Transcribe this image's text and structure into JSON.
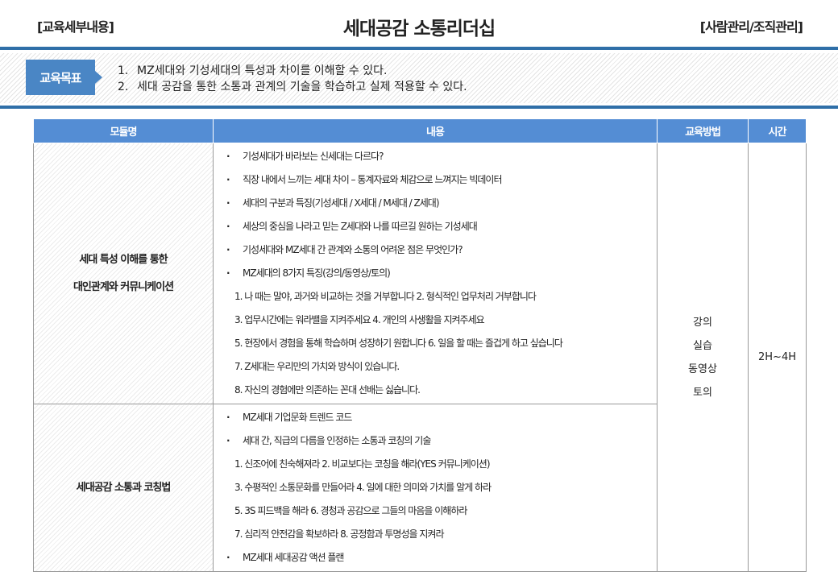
{
  "header": {
    "left": "[교육세부내용]",
    "title": "세대공감 소통리더십",
    "right": "[사람관리/조직관리]"
  },
  "objective": {
    "label": "교육목표",
    "items": [
      {
        "num": "1.",
        "text": "MZ세대와 기성세대의 특성과 차이를 이해할 수 있다."
      },
      {
        "num": "2.",
        "text": "세대 공감을 통한 소통과 관계의 기술을 학습하고 실제 적용할 수 있다."
      }
    ]
  },
  "table": {
    "headers": [
      "모듈명",
      "내용",
      "교육방법",
      "시간"
    ],
    "modules": [
      {
        "title_lines": [
          "세대 특성 이해를 통한",
          "대인관계와 커뮤니케이션"
        ],
        "lines": [
          {
            "type": "bullet",
            "text": "기성세대가 바라보는 신세대는 다르다?"
          },
          {
            "type": "bullet",
            "text": "직장 내에서 느끼는 세대 차이 – 통계자료와 체감으로 느껴지는 빅데이터"
          },
          {
            "type": "bullet",
            "text": "세대의 구분과 특징(기성세대 / X세대 / M세대 / Z세대)"
          },
          {
            "type": "bullet",
            "text": "세상의 중심을 나라고 믿는 Z세대와 나를 따르길 원하는 기성세대"
          },
          {
            "type": "bullet",
            "text": "기성세대와 MZ세대 간 관계와 소통의 어려운 점은 무엇인가?"
          },
          {
            "type": "bullet",
            "text": "MZ세대의 8가지 특징(강의/동영상/토의)"
          },
          {
            "type": "sub",
            "text": "1. 나 때는 말야, 과거와 비교하는 것을 거부합니다  2. 형식적인 업무처리 거부합니다"
          },
          {
            "type": "sub",
            "text": "3. 업무시간에는 워라밸을 지켜주세요  4. 개인의 사생활을 지켜주세요"
          },
          {
            "type": "sub",
            "text": "5. 현장에서 경험을 통해 학습하며 성장하기 원합니다  6. 일을 할 때는 즐겁게 하고 싶습니다"
          },
          {
            "type": "sub",
            "text": "7. Z세대는 우리만의 가치와 방식이 있습니다."
          },
          {
            "type": "sub",
            "text": "8. 자신의 경험에만 의존하는 꼰대 선배는 싫습니다."
          }
        ]
      },
      {
        "title_lines": [
          "세대공감 소통과 코칭법"
        ],
        "lines": [
          {
            "type": "bullet",
            "text": "MZ세대 기업문화 트렌드 코드"
          },
          {
            "type": "bullet",
            "text": "세대 간, 직급의 다름을 인정하는 소통과 코칭의 기술"
          },
          {
            "type": "sub",
            "text": "1. 신조어에 친숙해져라   2. 비교보다는 코칭을 해라(YES 커뮤니케이션)"
          },
          {
            "type": "sub",
            "text": "3. 수평적인 소통문화를 만들어라  4. 일에 대한 의미와 가치를 알게 하라"
          },
          {
            "type": "sub",
            "text": "5. 3S 피드백을 해라  6. 경청과 공감으로 그들의 마음을 이해하라"
          },
          {
            "type": "sub",
            "text": "7. 심리적 안전감을 확보하라  8. 공정함과 투명성을 지켜라"
          },
          {
            "type": "bullet",
            "text": "MZ세대 세대공감 액션 플랜"
          }
        ]
      }
    ],
    "methods": [
      "강의",
      "실습",
      "동영상",
      "토의"
    ],
    "time": "2H~4H"
  }
}
